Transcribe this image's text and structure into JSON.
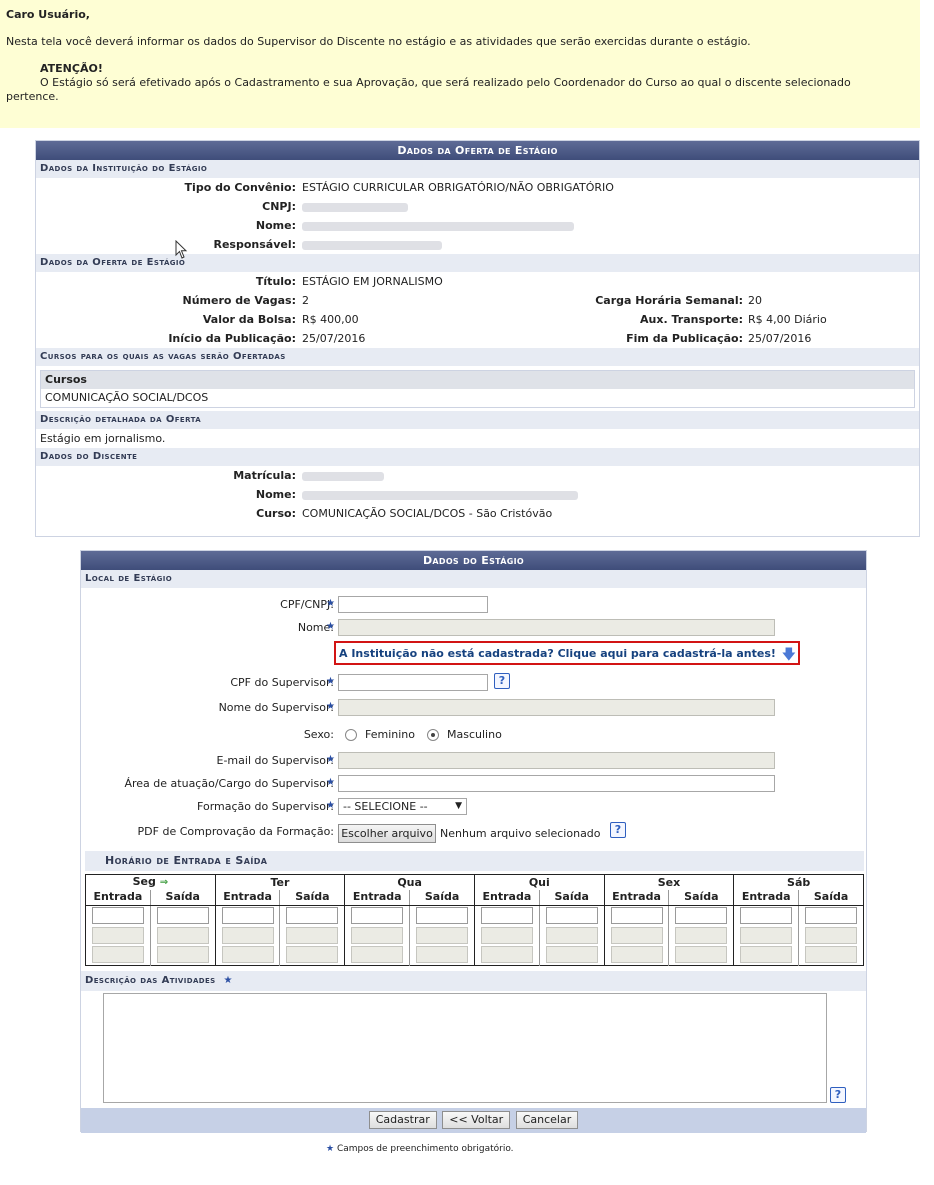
{
  "notice": {
    "greeting": "Caro Usuário,",
    "line1": "Nesta tela você deverá informar os dados do Supervisor do Discente no estágio e as atividades que serão exercidas durante o estágio.",
    "attention": "ATENÇÃO!",
    "line2": "O Estágio só será efetivado após o Cadastramento e sua Aprovação, que será realizado pelo Coordenador do Curso ao qual o discente selecionado",
    "line3": "pertence."
  },
  "oferta": {
    "title": "Dados da Oferta de Estágio",
    "instituicao": {
      "heading": "Dados da Instituição do Estágio",
      "tipo_label": "Tipo do Convênio:",
      "tipo_value": "ESTÁGIO CURRICULAR OBRIGATÓRIO/NÃO OBRIGATÓRIO",
      "cnpj_label": "CNPJ:",
      "nome_label": "Nome:",
      "responsavel_label": "Responsável:"
    },
    "dados": {
      "heading": "Dados da Oferta de Estágio",
      "titulo_label": "Título:",
      "titulo_value": "ESTÁGIO EM JORNALISMO",
      "vagas_label": "Número de Vagas:",
      "vagas_value": "2",
      "carga_label": "Carga Horária Semanal:",
      "carga_value": "20",
      "bolsa_label": "Valor da Bolsa:",
      "bolsa_value": "R$ 400,00",
      "transporte_label": "Aux. Transporte:",
      "transporte_value": "R$ 4,00 Diário",
      "inicio_label": "Início da Publicação:",
      "inicio_value": "25/07/2016",
      "fim_label": "Fim da Publicação:",
      "fim_value": "25/07/2016"
    },
    "cursos": {
      "heading": "Cursos para os quais as vagas serão Ofertadas",
      "col": "Cursos",
      "row": "COMUNICAÇÃO SOCIAL/DCOS"
    },
    "descricao": {
      "heading": "Descrição detalhada da Oferta",
      "text": "Estágio em jornalismo."
    },
    "discente": {
      "heading": "Dados do Discente",
      "matricula_label": "Matrícula:",
      "nome_label": "Nome:",
      "curso_label": "Curso:",
      "curso_value": "COMUNICAÇÃO SOCIAL/DCOS - São Cristóvão"
    }
  },
  "estagio": {
    "title": "Dados do Estágio",
    "local_heading": "Local de Estágio",
    "cpf_cnpj_label": "CPF/CNPJ:",
    "nome_label": "Nome:",
    "link_text": "A Instituição não está cadastrada? Clique aqui para cadastrá-la antes!",
    "cpf_sup_label": "CPF do Supervisor:",
    "nome_sup_label": "Nome do Supervisor:",
    "sexo_label": "Sexo:",
    "feminino": "Feminino",
    "masculino": "Masculino",
    "email_label": "E-mail do Supervisor:",
    "area_label": "Área de atuação/Cargo do Supervisor:",
    "formacao_label": "Formação do Supervisor:",
    "formacao_value": "-- SELECIONE --",
    "pdf_label": "PDF de Comprovação da Formação:",
    "file_button": "Escolher arquivo",
    "file_none": "Nenhum arquivo selecionado",
    "horario_heading": "Horário de Entrada e Saída",
    "days": [
      "Seg",
      "Ter",
      "Qua",
      "Qui",
      "Sex",
      "Sáb"
    ],
    "entrada": "Entrada",
    "saida": "Saída",
    "descricao_heading": "Descrição das Atividades",
    "buttons": {
      "cadastrar": "Cadastrar",
      "voltar": "<< Voltar",
      "cancelar": "Cancelar"
    }
  },
  "legend": "Campos de preenchimento obrigatório.",
  "icons": {
    "required": "star-icon",
    "help": "help-icon",
    "link_arrow": "down-arrow-icon",
    "seg_arrow": "green-right-arrow-icon"
  }
}
